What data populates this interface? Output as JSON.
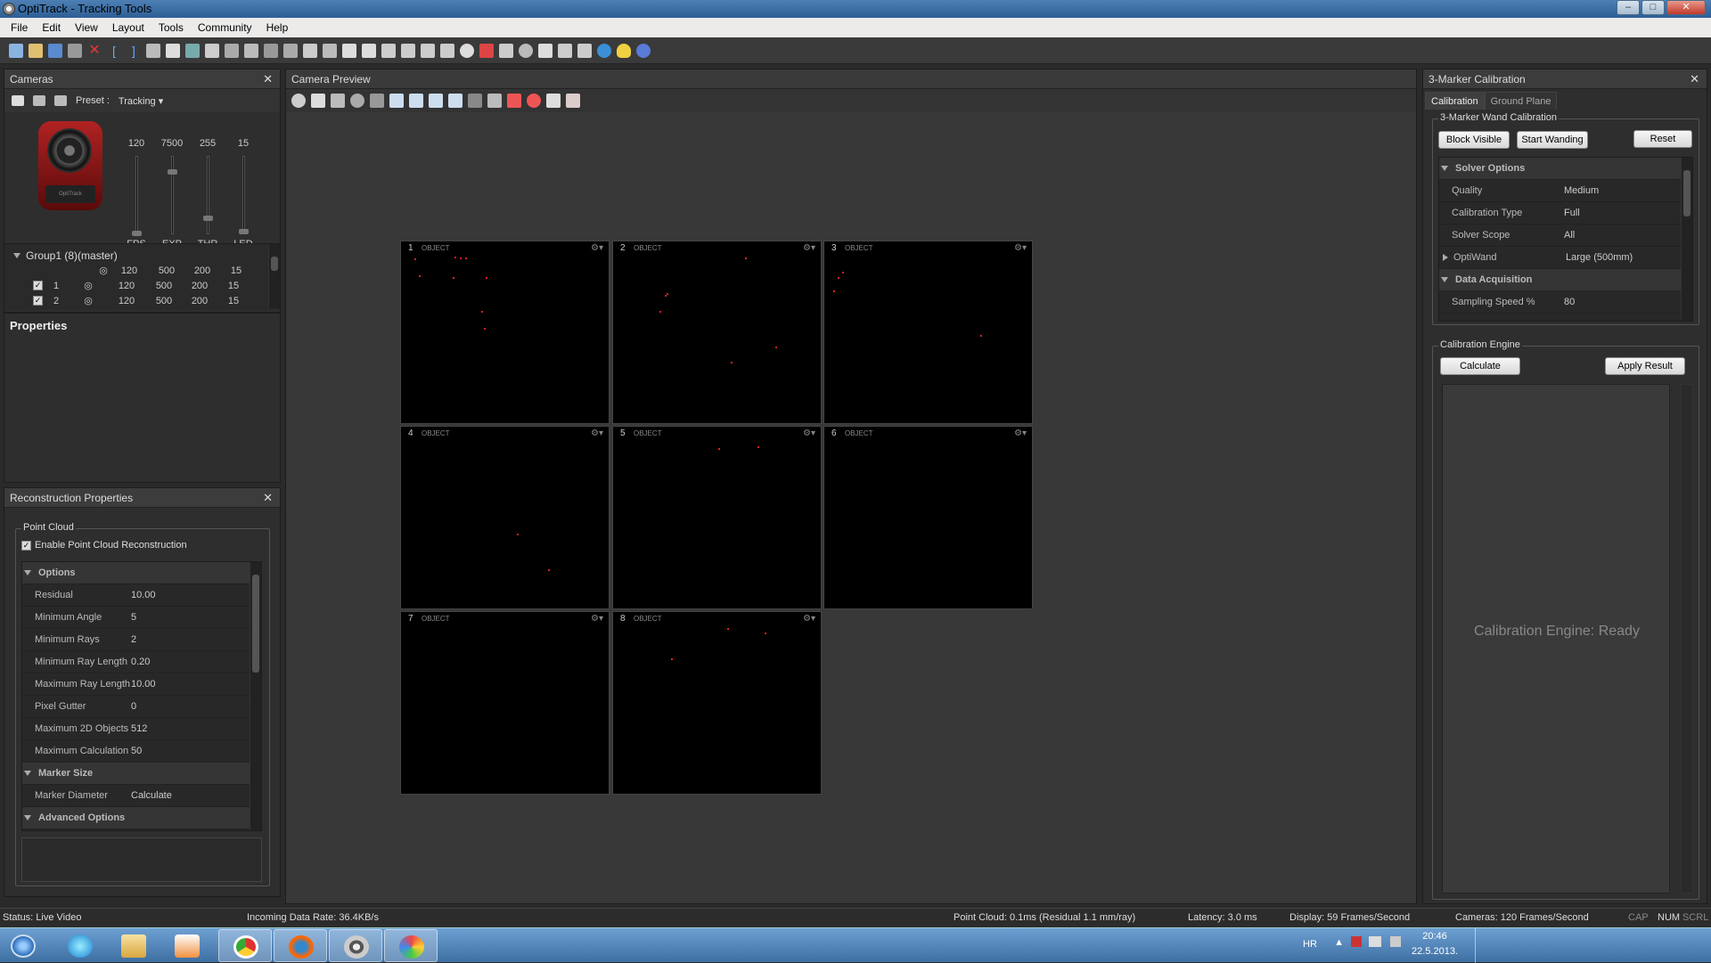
{
  "window": {
    "title": "OptiTrack - Tracking Tools",
    "minimize": "‒",
    "maximize": "□",
    "close": "✕"
  },
  "menu": [
    "File",
    "Edit",
    "View",
    "Layout",
    "Tools",
    "Community",
    "Help"
  ],
  "cameras": {
    "title": "Cameras",
    "close": "✕",
    "preset_label": "Preset :",
    "preset_value": "Tracking",
    "sliders": [
      {
        "value": "120",
        "label": "FPS",
        "level": 0
      },
      {
        "value": "7500",
        "label": "EXP",
        "level": 0.82
      },
      {
        "value": "255",
        "label": "THR",
        "level": 0.2
      },
      {
        "value": "15",
        "label": "LED",
        "level": 0.02
      }
    ],
    "model_caption": "OptiTrack",
    "group": {
      "name": "Group1 (8)(master)",
      "values": [
        "120",
        "500",
        "200",
        "15"
      ]
    },
    "rows": [
      {
        "id": "1",
        "values": [
          "120",
          "500",
          "200",
          "15"
        ]
      },
      {
        "id": "2",
        "values": [
          "120",
          "500",
          "200",
          "15"
        ]
      }
    ],
    "properties_title": "Properties"
  },
  "reconstruction": {
    "title": "Reconstruction Properties",
    "close": "✕",
    "group_label": "Point Cloud",
    "enable_label": "Enable Point Cloud Reconstruction",
    "sections": [
      {
        "name": "Options",
        "rows": [
          {
            "k": "Residual",
            "v": "10.00"
          },
          {
            "k": "Minimum Angle",
            "v": "5"
          },
          {
            "k": "Minimum Rays",
            "v": "2"
          },
          {
            "k": "Minimum Ray Length",
            "v": "0.20"
          },
          {
            "k": "Maximum Ray Length",
            "v": "10.00"
          },
          {
            "k": "Pixel Gutter",
            "v": "0"
          },
          {
            "k": "Maximum 2D Objects",
            "v": "512"
          },
          {
            "k": "Maximum Calculation Tim",
            "v": "50"
          }
        ]
      },
      {
        "name": "Marker Size",
        "rows": [
          {
            "k": "Marker Diameter",
            "v": "Calculate"
          }
        ]
      },
      {
        "name": "Advanced Options",
        "rows": []
      }
    ]
  },
  "preview": {
    "title": "Camera Preview",
    "views": [
      {
        "n": "1",
        "t": "OBJECT",
        "gear": "⚙▾"
      },
      {
        "n": "2",
        "t": "OBJECT",
        "gear": "⚙▾"
      },
      {
        "n": "3",
        "t": "OBJECT",
        "gear": "⚙▾"
      },
      {
        "n": "4",
        "t": "OBJECT",
        "gear": "⚙▾"
      },
      {
        "n": "5",
        "t": "OBJECT",
        "gear": "⚙▾"
      },
      {
        "n": "6",
        "t": "OBJECT",
        "gear": "⚙▾"
      },
      {
        "n": "7",
        "t": "OBJECT",
        "gear": "⚙▾"
      },
      {
        "n": "8",
        "t": "OBJECT",
        "gear": "⚙▾"
      }
    ]
  },
  "calibration": {
    "title": "3-Marker Calibration",
    "close": "✕",
    "tabs": [
      "Calibration",
      "Ground Plane"
    ],
    "wand_group": "3-Marker Wand Calibration",
    "buttons": {
      "block": "Block Visible",
      "start": "Start Wanding",
      "reset": "Reset",
      "calculate": "Calculate",
      "apply": "Apply Result"
    },
    "solver": {
      "name": "Solver Options",
      "rows": [
        {
          "k": "Quality",
          "v": "Medium"
        },
        {
          "k": "Calibration Type",
          "v": "Full"
        },
        {
          "k": "Solver Scope",
          "v": "All"
        }
      ]
    },
    "optiwand": {
      "k": "OptiWand",
      "v": "Large (500mm)"
    },
    "acq": {
      "name": "Data Acquisition",
      "rows": [
        {
          "k": "Sampling Speed %",
          "v": "80"
        }
      ]
    },
    "engine_group": "Calibration Engine",
    "engine_status": "Calibration Engine: Ready"
  },
  "status": {
    "state": "Status: Live Video",
    "rate": "Incoming Data Rate: 36.4KB/s",
    "pointcloud": "Point Cloud: 0.1ms (Residual 1.1 mm/ray)",
    "latency": "Latency: 3.0 ms",
    "display": "Display: 59 Frames/Second",
    "cameras": "Cameras: 120 Frames/Second",
    "cap": "CAP",
    "num": "NUM",
    "scrl": "SCRL"
  },
  "taskbar": {
    "lang": "HR",
    "time": "20:46",
    "date": "22.5.2013."
  }
}
